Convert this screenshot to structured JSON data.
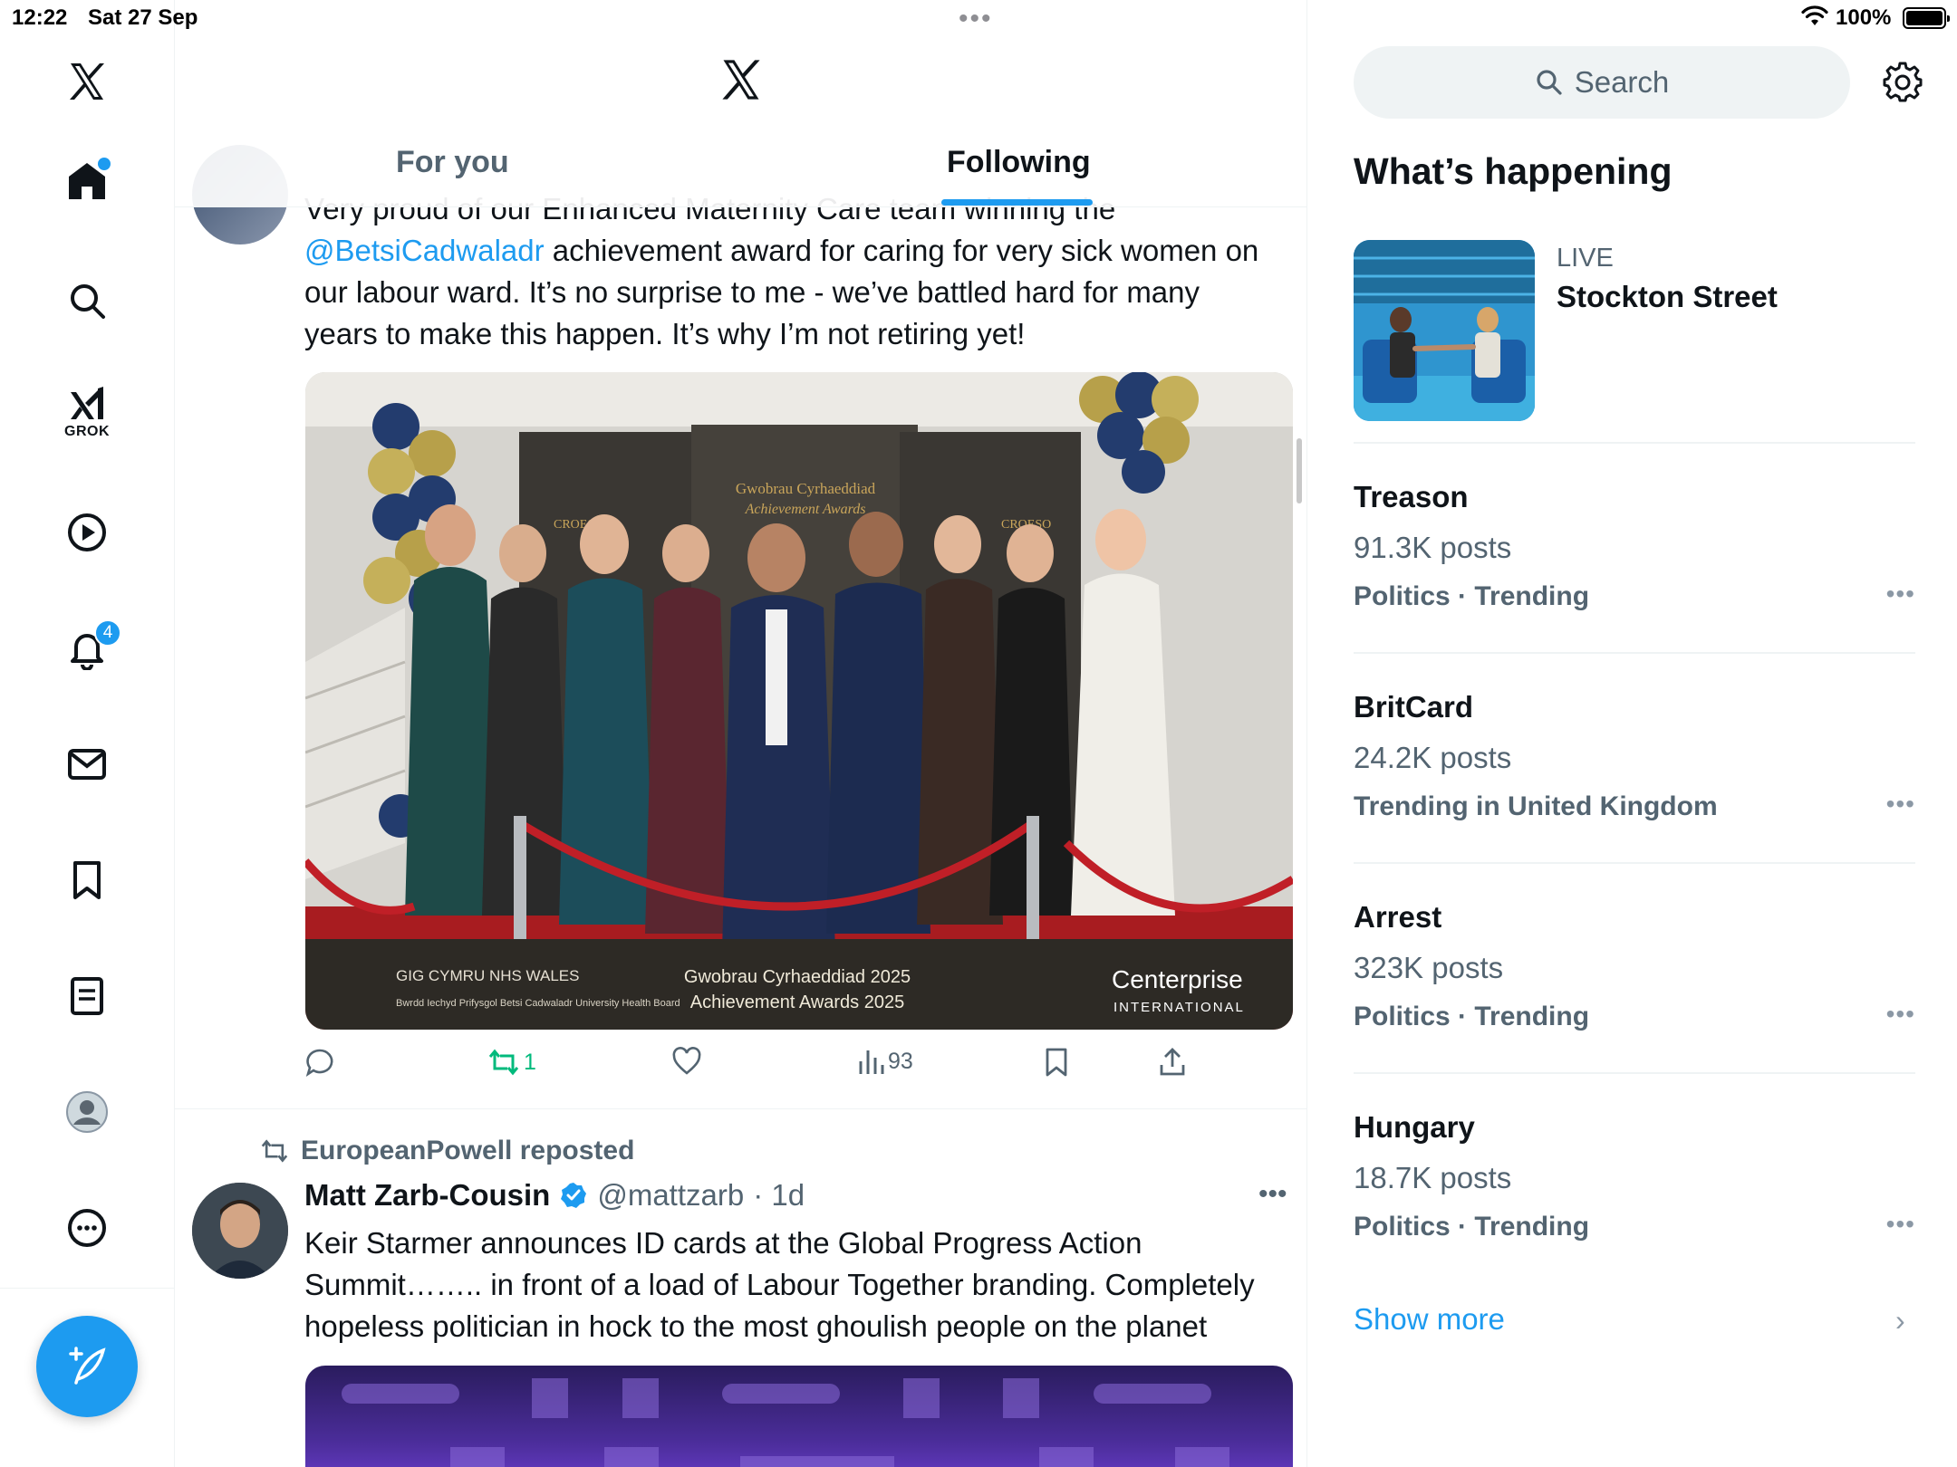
{
  "status_bar": {
    "time": "12:22",
    "date": "Sat 27 Sep",
    "battery": "100%"
  },
  "nav": {
    "grok_label": "GROK",
    "notifications_count": "4"
  },
  "header": {
    "tabs": [
      {
        "label": "For you",
        "active": false
      },
      {
        "label": "Following",
        "active": true
      }
    ]
  },
  "post1": {
    "text_line0": "Very proud of our Enhanced Maternity Care team winning the",
    "mention": "@BetsiCadwaladr",
    "text_line1_rest": " achievement award for caring for very sick women on",
    "text_line2": "our labour ward. It’s no surprise to me - we’ve battled hard for many",
    "text_line3": "years to make this happen. It’s why I’m not retiring yet!",
    "image": {
      "banner_center": "Gwobrau Cyrhaeddiad",
      "banner_center2": "Achievement Awards",
      "banner_left": "CROESO",
      "banner_right": "CROESO",
      "footer_nhs": "GIG CYMRU NHS WALES",
      "footer_board": "Bwrdd Iechyd Prifysgol Betsi Cadwaladr University Health Board",
      "footer_awards1": "Gwobrau Cyrhaeddiad 2025",
      "footer_awards2": "Achievement Awards 2025",
      "footer_sponsor": "Centerprise",
      "footer_sponsor_sub": "INTERNATIONAL"
    },
    "retweets": "1",
    "views": "93"
  },
  "post2": {
    "reposted_by": "EuropeanPowell reposted",
    "author_name": "Matt Zarb-Cousin",
    "author_handle": "@mattzarb",
    "time": "· 1d",
    "text_line1": "Keir Starmer announces ID cards at the Global Progress Action",
    "text_line2": "Summit…….. in front of a load of Labour Together branding. Completely",
    "text_line3": "hopeless politician in hock to the most ghoulish people on the planet"
  },
  "sidebar": {
    "search_placeholder": "Search",
    "whats_happening": "What’s happening",
    "live": {
      "tag": "LIVE",
      "name": "Stockton Street"
    },
    "trends": [
      {
        "name": "Treason",
        "posts": "91.3K posts",
        "context": "Politics · Trending"
      },
      {
        "name": "BritCard",
        "posts": "24.2K posts",
        "context": "Trending in United Kingdom"
      },
      {
        "name": "Arrest",
        "posts": "323K posts",
        "context": "Politics · Trending"
      },
      {
        "name": "Hungary",
        "posts": "18.7K posts",
        "context": "Politics · Trending"
      }
    ],
    "show_more": "Show more"
  },
  "colors": {
    "accent": "#1d9bf0",
    "retweet": "#00ba7c",
    "muted": "#536471"
  }
}
